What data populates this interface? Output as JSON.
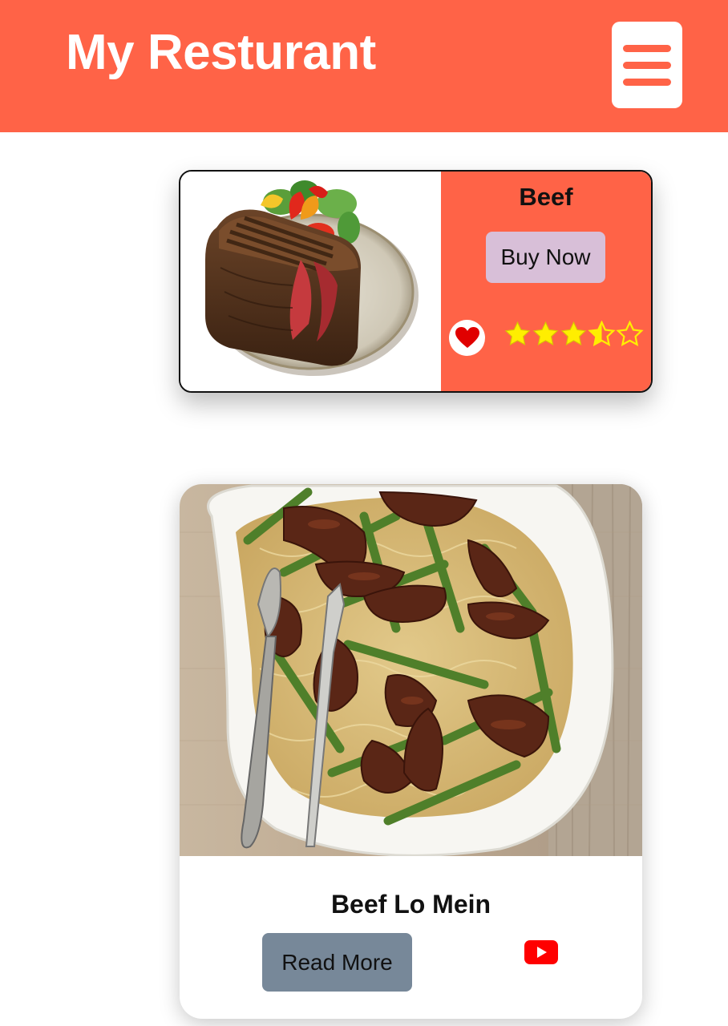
{
  "header": {
    "title": "My Resturant",
    "menu_icon": "hamburger-menu-icon"
  },
  "colors": {
    "brand": "#ff6347",
    "buy_button": "#d8bfd8",
    "read_more_button": "#778899",
    "star": "#ffee00",
    "heart": "#e00000",
    "youtube": "#ff0000"
  },
  "cards": [
    {
      "title": "Beef",
      "button_label": "Buy Now",
      "image": "steak-plate-image",
      "favorite_icon": "heart-icon",
      "rating": 3.5,
      "rating_max": 5
    },
    {
      "title": "Beef Lo Mein",
      "button_label": "Read More",
      "image": "beef-lo-mein-image",
      "video_icon": "youtube-icon"
    }
  ]
}
